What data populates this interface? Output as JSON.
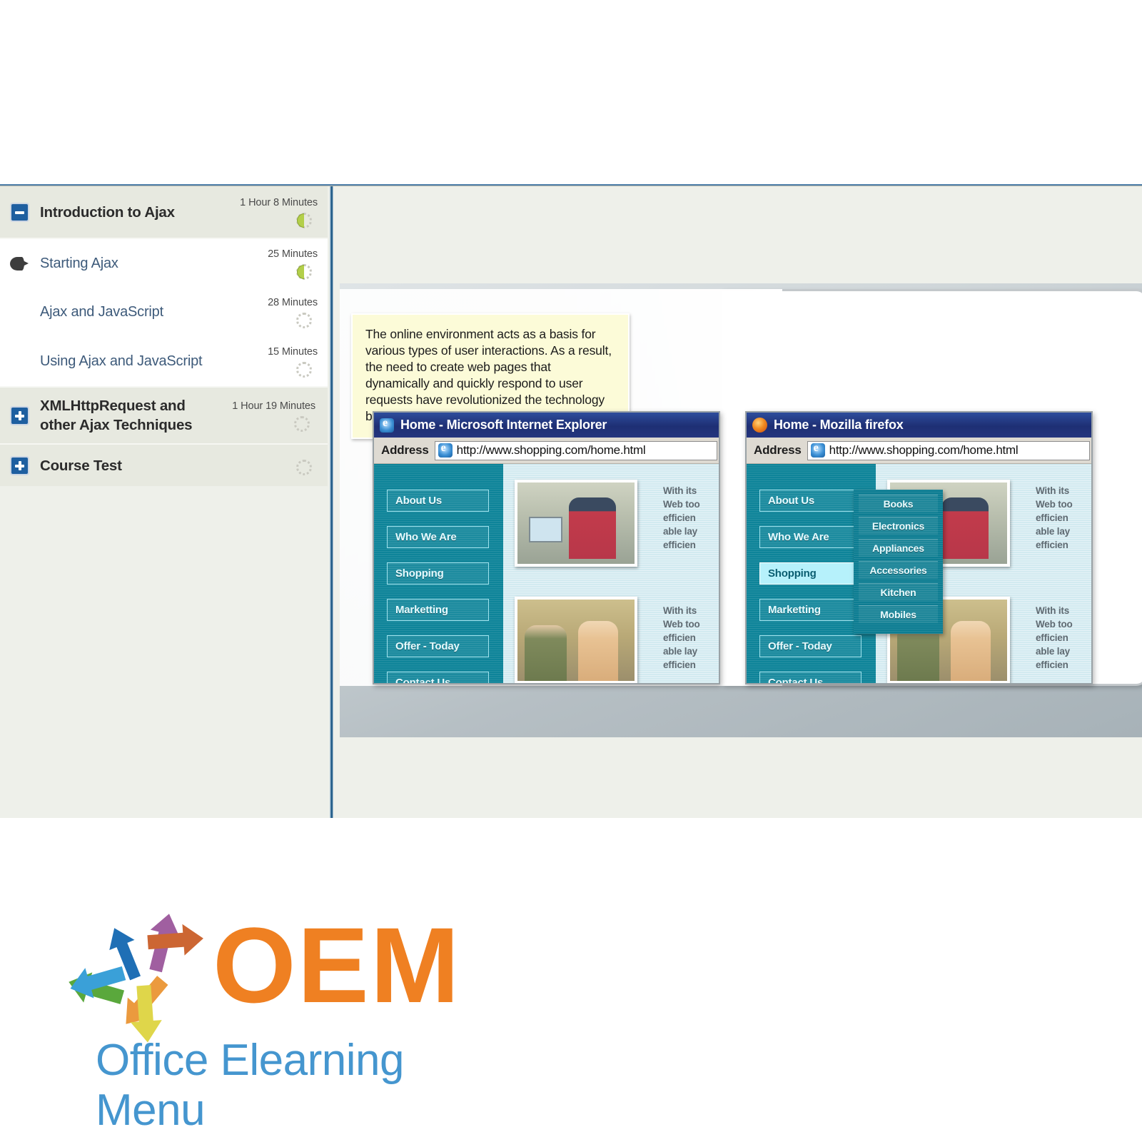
{
  "sidebar": {
    "items": [
      {
        "label": "Introduction to Ajax",
        "duration": "1 Hour 8 Minutes",
        "level": 1,
        "icon": "minus-box-icon",
        "progress": "half"
      },
      {
        "label": "Starting Ajax",
        "duration": "25 Minutes",
        "level": 2,
        "icon": "bullet-pointer-icon",
        "progress": "half"
      },
      {
        "label": "Ajax and JavaScript",
        "duration": "28 Minutes",
        "level": 2,
        "icon": "none",
        "progress": "empty"
      },
      {
        "label": "Using Ajax and JavaScript",
        "duration": "15 Minutes",
        "level": 2,
        "icon": "none",
        "progress": "empty"
      },
      {
        "label": "XMLHttpRequest and other Ajax Techniques",
        "duration": "1 Hour 19 Minutes",
        "level": 1,
        "icon": "plus-box-icon",
        "progress": "empty"
      },
      {
        "label": "Course Test",
        "duration": "",
        "level": 1,
        "icon": "plus-box-icon",
        "progress": "empty"
      }
    ]
  },
  "slide": {
    "note": "The online environment acts as a basis for various types of user interactions. As a result, the need to create web pages that dynamically and quickly respond to user requests have revolutionized the technology behind it.",
    "browsers": [
      {
        "id": "ie",
        "title": "Home - Microsoft Internet Explorer",
        "icon": "internet-explorer-icon",
        "address_label": "Address",
        "url": "http://www.shopping.com/home.html",
        "nav": [
          {
            "label": "About Us",
            "active": false
          },
          {
            "label": "Who We Are",
            "active": false
          },
          {
            "label": "Shopping",
            "active": false
          },
          {
            "label": "Marketting",
            "active": false
          },
          {
            "label": "Offer - Today",
            "active": false
          },
          {
            "label": "Contact Us",
            "active": false
          }
        ],
        "dropdown": [],
        "blurb": [
          "With its",
          "Web too",
          "efficien",
          "able lay",
          "efficien"
        ]
      },
      {
        "id": "ff",
        "title": "Home - Mozilla firefox",
        "icon": "firefox-icon",
        "address_label": "Address",
        "url": "http://www.shopping.com/home.html",
        "nav": [
          {
            "label": "About Us",
            "active": false
          },
          {
            "label": "Who We Are",
            "active": false
          },
          {
            "label": "Shopping",
            "active": true
          },
          {
            "label": "Marketting",
            "active": false
          },
          {
            "label": "Offer - Today",
            "active": false
          },
          {
            "label": "Contact Us",
            "active": false
          }
        ],
        "dropdown": [
          "Books",
          "Electronics",
          "Appliances",
          "Accessories",
          "Kitchen",
          "Mobiles"
        ],
        "blurb": [
          "With its",
          "Web too",
          "efficien",
          "able lay",
          "efficien"
        ]
      }
    ]
  },
  "logo": {
    "wordmark": "OEM",
    "tagline": "Office Elearning Menu",
    "wordmark_color": "#ef8022",
    "tagline_color": "#4596cf",
    "arrow_colors": [
      "#1f6fb5",
      "#a05fa0",
      "#cc6633",
      "#eb9a3e",
      "#dfd64a",
      "#5aa83c",
      "#3aa0d8"
    ]
  }
}
